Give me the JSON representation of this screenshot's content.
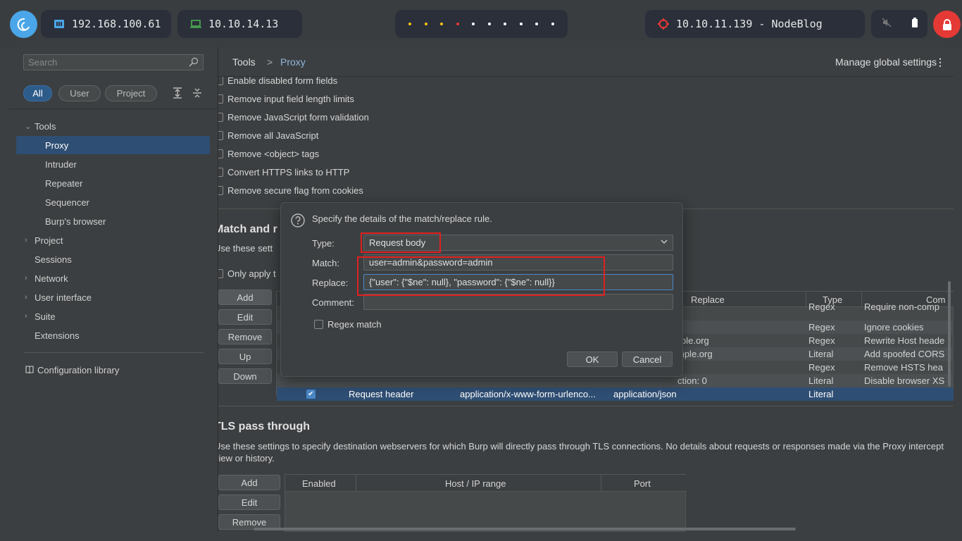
{
  "system_bar": {
    "ip_local": "192.168.100.61",
    "ip_vpn": "10.10.14.13",
    "target": "10.10.11.139 - NodeBlog",
    "workspace_dot_colors": [
      "#f5c518",
      "#f5c518",
      "#f5c518",
      "#e53935",
      "#ffffff",
      "#ffffff",
      "#ffffff",
      "#ffffff",
      "#ffffff",
      "#ffffff"
    ]
  },
  "sidebar": {
    "search_placeholder": "Search",
    "filters": [
      "All",
      "User",
      "Project"
    ],
    "tree": {
      "tools": "Tools",
      "proxy": "Proxy",
      "intruder": "Intruder",
      "repeater": "Repeater",
      "sequencer": "Sequencer",
      "burps_browser": "Burp's browser",
      "project": "Project",
      "sessions": "Sessions",
      "network": "Network",
      "user_interface": "User interface",
      "suite": "Suite",
      "extensions": "Extensions"
    },
    "config_library": "Configuration library"
  },
  "header": {
    "crumb_tools": "Tools",
    "crumb_sep": ">",
    "crumb_proxy": "Proxy",
    "manage": "Manage global settings"
  },
  "options": [
    "Enable disabled form fields",
    "Remove input field length limits",
    "Remove JavaScript form validation",
    "Remove all JavaScript",
    "Remove <object> tags",
    "Convert HTTPS links to HTTP",
    "Remove secure flag from cookies"
  ],
  "match_replace": {
    "title": "Match and r",
    "desc": "Use these sett",
    "only_apply": "Only apply t",
    "buttons": [
      "Add",
      "Edit",
      "Remove",
      "Up",
      "Down"
    ],
    "columns": {
      "replace": "Replace",
      "type": "Type",
      "comment": "Com"
    },
    "rows": [
      {
        "replace": "",
        "type": "Regex",
        "comment": "Require non-comp"
      },
      {
        "replace": "",
        "type": "Regex",
        "comment": "Ignore cookies"
      },
      {
        "replace": "ple.org",
        "type": "Regex",
        "comment": "Rewrite Host heade"
      },
      {
        "replace": "mple.org",
        "type": "Literal",
        "comment": "Add spoofed CORS"
      },
      {
        "replace": "",
        "type": "Regex",
        "comment": "Remove HSTS hea"
      },
      {
        "replace": "ction: 0",
        "type": "Literal",
        "comment": "Disable browser XS"
      }
    ],
    "selected_row": {
      "item": "Request header",
      "match": "application/x-www-form-urlenco...",
      "replace": "application/json",
      "type": "Literal"
    }
  },
  "tls": {
    "title": "TLS pass through",
    "desc": "Use these settings to specify destination webservers for which Burp will directly pass through TLS connections. No details about requests or responses made via the Proxy intercept view or history.",
    "buttons": [
      "Add",
      "Edit",
      "Remove"
    ],
    "columns": [
      "Enabled",
      "Host / IP range",
      "Port"
    ]
  },
  "dialog": {
    "prompt": "Specify the details of the match/replace rule.",
    "type_label": "Type:",
    "type_value": "Request body",
    "match_label": "Match:",
    "match_value": "user=admin&password=admin",
    "replace_label": "Replace:",
    "replace_value": "{\"user\": {\"$ne\": null}, \"password\": {\"$ne\": null}}",
    "comment_label": "Comment:",
    "comment_value": "",
    "regex_label": "Regex match",
    "ok": "OK",
    "cancel": "Cancel"
  },
  "colors": {
    "accent": "#2f4e73",
    "highlight": "#e0201f",
    "lock": "#e53935"
  }
}
